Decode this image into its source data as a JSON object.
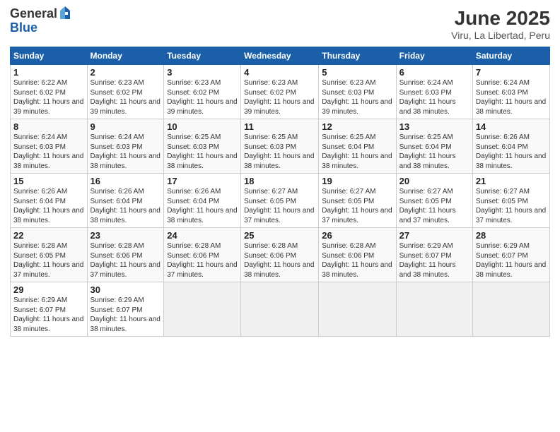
{
  "header": {
    "logo_general": "General",
    "logo_blue": "Blue",
    "title": "June 2025",
    "subtitle": "Viru, La Libertad, Peru"
  },
  "days_of_week": [
    "Sunday",
    "Monday",
    "Tuesday",
    "Wednesday",
    "Thursday",
    "Friday",
    "Saturday"
  ],
  "weeks": [
    [
      {
        "day": "1",
        "sunrise": "6:22 AM",
        "sunset": "6:02 PM",
        "daylight": "11 hours and 39 minutes."
      },
      {
        "day": "2",
        "sunrise": "6:23 AM",
        "sunset": "6:02 PM",
        "daylight": "11 hours and 39 minutes."
      },
      {
        "day": "3",
        "sunrise": "6:23 AM",
        "sunset": "6:02 PM",
        "daylight": "11 hours and 39 minutes."
      },
      {
        "day": "4",
        "sunrise": "6:23 AM",
        "sunset": "6:02 PM",
        "daylight": "11 hours and 39 minutes."
      },
      {
        "day": "5",
        "sunrise": "6:23 AM",
        "sunset": "6:03 PM",
        "daylight": "11 hours and 39 minutes."
      },
      {
        "day": "6",
        "sunrise": "6:24 AM",
        "sunset": "6:03 PM",
        "daylight": "11 hours and 38 minutes."
      },
      {
        "day": "7",
        "sunrise": "6:24 AM",
        "sunset": "6:03 PM",
        "daylight": "11 hours and 38 minutes."
      }
    ],
    [
      {
        "day": "8",
        "sunrise": "6:24 AM",
        "sunset": "6:03 PM",
        "daylight": "11 hours and 38 minutes."
      },
      {
        "day": "9",
        "sunrise": "6:24 AM",
        "sunset": "6:03 PM",
        "daylight": "11 hours and 38 minutes."
      },
      {
        "day": "10",
        "sunrise": "6:25 AM",
        "sunset": "6:03 PM",
        "daylight": "11 hours and 38 minutes."
      },
      {
        "day": "11",
        "sunrise": "6:25 AM",
        "sunset": "6:03 PM",
        "daylight": "11 hours and 38 minutes."
      },
      {
        "day": "12",
        "sunrise": "6:25 AM",
        "sunset": "6:04 PM",
        "daylight": "11 hours and 38 minutes."
      },
      {
        "day": "13",
        "sunrise": "6:25 AM",
        "sunset": "6:04 PM",
        "daylight": "11 hours and 38 minutes."
      },
      {
        "day": "14",
        "sunrise": "6:26 AM",
        "sunset": "6:04 PM",
        "daylight": "11 hours and 38 minutes."
      }
    ],
    [
      {
        "day": "15",
        "sunrise": "6:26 AM",
        "sunset": "6:04 PM",
        "daylight": "11 hours and 38 minutes."
      },
      {
        "day": "16",
        "sunrise": "6:26 AM",
        "sunset": "6:04 PM",
        "daylight": "11 hours and 38 minutes."
      },
      {
        "day": "17",
        "sunrise": "6:26 AM",
        "sunset": "6:04 PM",
        "daylight": "11 hours and 38 minutes."
      },
      {
        "day": "18",
        "sunrise": "6:27 AM",
        "sunset": "6:05 PM",
        "daylight": "11 hours and 37 minutes."
      },
      {
        "day": "19",
        "sunrise": "6:27 AM",
        "sunset": "6:05 PM",
        "daylight": "11 hours and 37 minutes."
      },
      {
        "day": "20",
        "sunrise": "6:27 AM",
        "sunset": "6:05 PM",
        "daylight": "11 hours and 37 minutes."
      },
      {
        "day": "21",
        "sunrise": "6:27 AM",
        "sunset": "6:05 PM",
        "daylight": "11 hours and 37 minutes."
      }
    ],
    [
      {
        "day": "22",
        "sunrise": "6:28 AM",
        "sunset": "6:05 PM",
        "daylight": "11 hours and 37 minutes."
      },
      {
        "day": "23",
        "sunrise": "6:28 AM",
        "sunset": "6:06 PM",
        "daylight": "11 hours and 37 minutes."
      },
      {
        "day": "24",
        "sunrise": "6:28 AM",
        "sunset": "6:06 PM",
        "daylight": "11 hours and 37 minutes."
      },
      {
        "day": "25",
        "sunrise": "6:28 AM",
        "sunset": "6:06 PM",
        "daylight": "11 hours and 38 minutes."
      },
      {
        "day": "26",
        "sunrise": "6:28 AM",
        "sunset": "6:06 PM",
        "daylight": "11 hours and 38 minutes."
      },
      {
        "day": "27",
        "sunrise": "6:29 AM",
        "sunset": "6:07 PM",
        "daylight": "11 hours and 38 minutes."
      },
      {
        "day": "28",
        "sunrise": "6:29 AM",
        "sunset": "6:07 PM",
        "daylight": "11 hours and 38 minutes."
      }
    ],
    [
      {
        "day": "29",
        "sunrise": "6:29 AM",
        "sunset": "6:07 PM",
        "daylight": "11 hours and 38 minutes."
      },
      {
        "day": "30",
        "sunrise": "6:29 AM",
        "sunset": "6:07 PM",
        "daylight": "11 hours and 38 minutes."
      },
      null,
      null,
      null,
      null,
      null
    ]
  ]
}
